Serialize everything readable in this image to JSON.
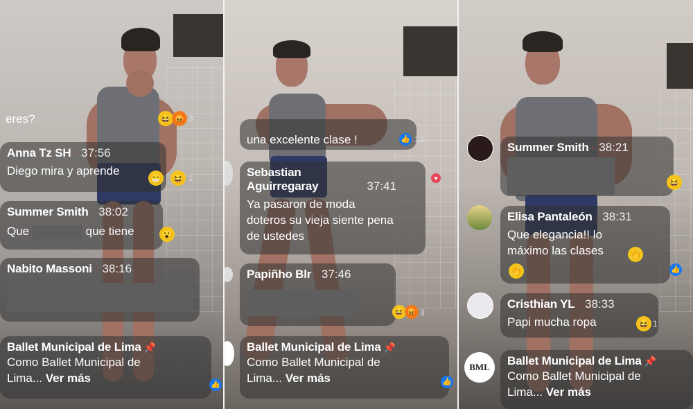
{
  "panel1": {
    "partial_text": "eres?",
    "partial_count": "3",
    "c1": {
      "name": "Anna Tz SH",
      "time": "37:56",
      "text": "Diego mira y aprende",
      "count": "1"
    },
    "c2": {
      "name": "Summer Smith",
      "time": "38:02",
      "text_before": "Que",
      "text_after": "que tiene"
    },
    "c3": {
      "name": "Nabito Massoni",
      "time": "38:16"
    },
    "c4": {
      "name": "Ballet Municipal de Lima",
      "line1": "Como Ballet Municipal de",
      "line2": "Lima...",
      "more": "Ver más"
    }
  },
  "panel2": {
    "partial_text": "una excelente clase !",
    "partial_count": "13",
    "c1": {
      "name_line1": "Sebastian",
      "name_line2": "Aguirregaray",
      "time": "37:41",
      "line1": "Ya pasaron de moda",
      "line2": "doteros su vieja siente pena",
      "line3": "de ustedes"
    },
    "c2": {
      "name": "Papiñho Blr",
      "time": "37:46",
      "count": "3"
    },
    "c3": {
      "name": "Ballet Municipal de Lima",
      "line1": "Como Ballet Municipal de",
      "line2": "Lima...",
      "more": "Ver más"
    }
  },
  "panel3": {
    "c1": {
      "name": "Summer Smith",
      "time": "38:21"
    },
    "c2": {
      "name": "Elisa Pantaleón",
      "time": "38:31",
      "line1": "Que elegancia!! lo",
      "line2": "máximo las clases"
    },
    "c3": {
      "name": "Cristhian YL",
      "time": "38:33",
      "text": "Papi mucha ropa",
      "count": "1"
    },
    "c4": {
      "name": "Ballet Municipal de Lima",
      "line1": "Como Ballet Municipal de",
      "line2": "Lima...",
      "more": "Ver más",
      "avatar_text": "BML"
    }
  }
}
